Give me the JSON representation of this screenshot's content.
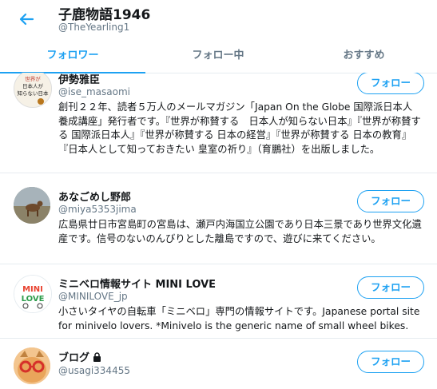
{
  "header": {
    "back_icon": "arrow-left-icon",
    "title": "子鹿物語1946",
    "handle": "@TheYearling1"
  },
  "tabs": [
    {
      "label": "フォロワー",
      "active": true
    },
    {
      "label": "フォロー中",
      "active": false
    },
    {
      "label": "おすすめ",
      "active": false
    }
  ],
  "colors": {
    "accent": "#1da1f2",
    "text": "#14171a",
    "muted": "#657786",
    "divider": "#e6ecf0"
  },
  "users": [
    {
      "name": "伊勢雅臣",
      "handle": "@ise_masaomi",
      "avatar_text": "世界が 日本人が 知らない日本",
      "bio": "創刊２２年、読者５万人のメールマガジン「Japan On the Globe 国際派日本人養成講座」発行者です。『世界が称賛する　日本人が知らない日本』『世界が称賛する 国際派日本人』『世界が称賛する 日本の経営』『世界が称賛する 日本の教育』『日本人として知っておきたい 皇室の祈り』（育鵬社）を出版しました。",
      "follow_label": "フォロー"
    },
    {
      "name": "あなごめし野郎",
      "handle": "@miya5353jima",
      "bio": "広島県廿日市宮島町の宮島は、瀬戸内海国立公園であり日本三景であり世界文化遺産です。信号のないのんびりとした離島ですので、遊びに来てください。",
      "follow_label": "フォロー"
    },
    {
      "name": "ミニベロ情報サイト MINI LOVE",
      "handle": "@MINILOVE_jp",
      "avatar_text": "MINI LOVE",
      "bio": "小さいタイヤの自転車「ミニベロ」専門の情報サイトです。Japanese portal site for minivelo lovers. *Minivelo is the generic name of small wheel bikes.",
      "follow_label": "フォロー"
    },
    {
      "name": "ブログ",
      "handle": "@usagi334455",
      "protected_icon": "lock-icon",
      "follow_label": "フォロー"
    }
  ]
}
